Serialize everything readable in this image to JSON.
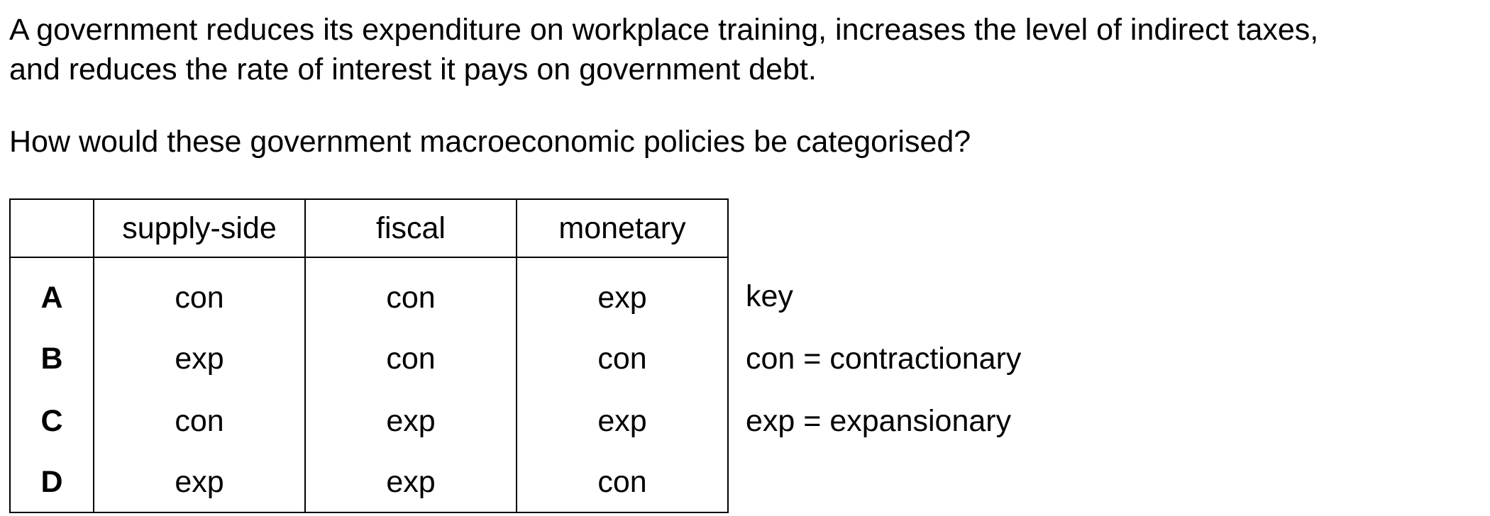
{
  "stem": {
    "line1": "A government reduces its expenditure on workplace training, increases the level of indirect taxes,",
    "line2": "and reduces the rate of interest it pays on government debt."
  },
  "question": "How would these government macroeconomic policies be categorised?",
  "table": {
    "headers": [
      "",
      "supply-side",
      "fiscal",
      "monetary"
    ],
    "rows": [
      {
        "letter": "A",
        "cells": [
          "con",
          "con",
          "exp"
        ]
      },
      {
        "letter": "B",
        "cells": [
          "exp",
          "con",
          "con"
        ]
      },
      {
        "letter": "C",
        "cells": [
          "con",
          "exp",
          "exp"
        ]
      },
      {
        "letter": "D",
        "cells": [
          "exp",
          "exp",
          "con"
        ]
      }
    ]
  },
  "key": {
    "title": "key",
    "con": "con = contractionary",
    "exp": "exp = expansionary"
  }
}
